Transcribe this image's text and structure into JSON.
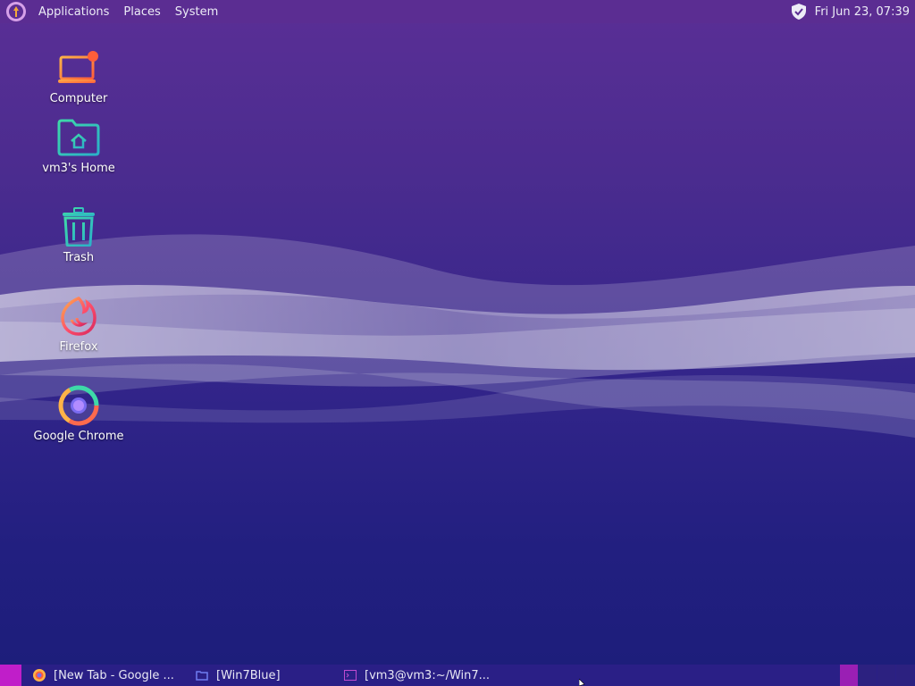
{
  "top_panel": {
    "menus": [
      "Applications",
      "Places",
      "System"
    ],
    "clock": "Fri Jun 23, 07:39",
    "icons": {
      "logo": "distro-logo-icon",
      "tray": "shield-check-icon"
    }
  },
  "desktop": {
    "icons": [
      {
        "label": "Computer",
        "icon": "computer-icon"
      },
      {
        "label": "vm3's Home",
        "icon": "home-folder-icon"
      },
      {
        "label": "Trash",
        "icon": "trash-icon"
      },
      {
        "label": "Firefox",
        "icon": "firefox-icon"
      },
      {
        "label": "Google Chrome",
        "icon": "chrome-icon"
      }
    ]
  },
  "taskbar": {
    "tasks": [
      {
        "label": "[New Tab - Google ...",
        "icon": "chrome-icon"
      },
      {
        "label": "[Win7Blue]",
        "icon": "folder-icon"
      },
      {
        "label": "[vm3@vm3:~/Win7...",
        "icon": "terminal-icon"
      }
    ],
    "workspaces": 4,
    "active_workspace": 1
  },
  "colors": {
    "top_panel": "#5b2d92",
    "bottom_panel": "#2a1f86",
    "accent": "#c01ec9"
  }
}
